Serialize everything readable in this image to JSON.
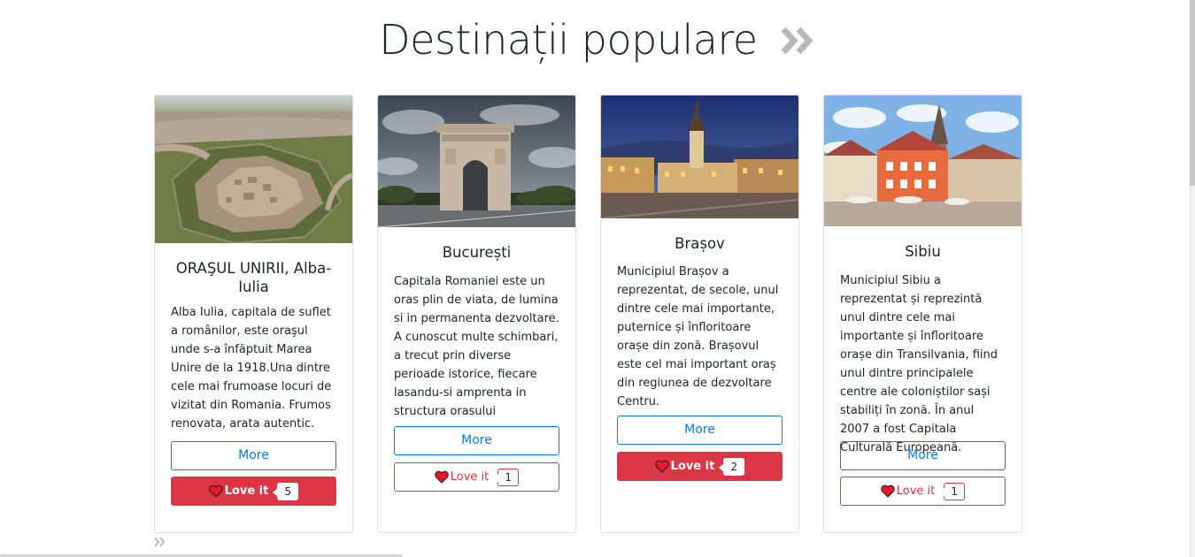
{
  "section": {
    "title": "Destinații populare",
    "arrow_icon": "double-chevron-right-icon"
  },
  "colors": {
    "primary": "#007bff",
    "danger": "#dc3545"
  },
  "cards": [
    {
      "title": "ORAŞUL UNIRII, Alba-Iulia",
      "text": "Alba Iulia, capitala de suflet a românilor, este oraşul unde s-a înfăptuit Marea Unire de la 1918.Una dintre cele mai frumoase locuri de vizitat din Romania. Frumos renovata, arata autentic.",
      "more_label": "More",
      "love_label": "Love it",
      "love_count": "5",
      "loved": true
    },
    {
      "title": "București",
      "text": "Capitala Romaniei este un oras plin de viata, de lumina si in permanenta dezvoltare. A cunoscut multe schimbari, a trecut prin diverse perioade istorice, fiecare lasandu-si amprenta in structura orasului",
      "more_label": "More",
      "love_label": "Love it",
      "love_count": "1",
      "loved": false
    },
    {
      "title": "Brașov",
      "text": "Municipiul Brașov a reprezentat, de secole, unul dintre cele mai importante, puternice și înfloritoare orașe din zonă. Brașovul este cel mai important oraș din regiunea de dezvoltare Centru.",
      "more_label": "More",
      "love_label": "Love it",
      "love_count": "2",
      "loved": true
    },
    {
      "title": "Sibiu",
      "text": "Municipiul Sibiu a reprezentat și reprezintă unul dintre cele mai importante și înfloritoare orașe din Transilvania, fiind unul dintre principalele centre ale coloniștilor sași stabiliți în zonă. În anul 2007 a fost Capitala Culturală Europeană.",
      "more_label": "More",
      "love_label": "Love it",
      "love_count": "1",
      "loved": false
    }
  ]
}
